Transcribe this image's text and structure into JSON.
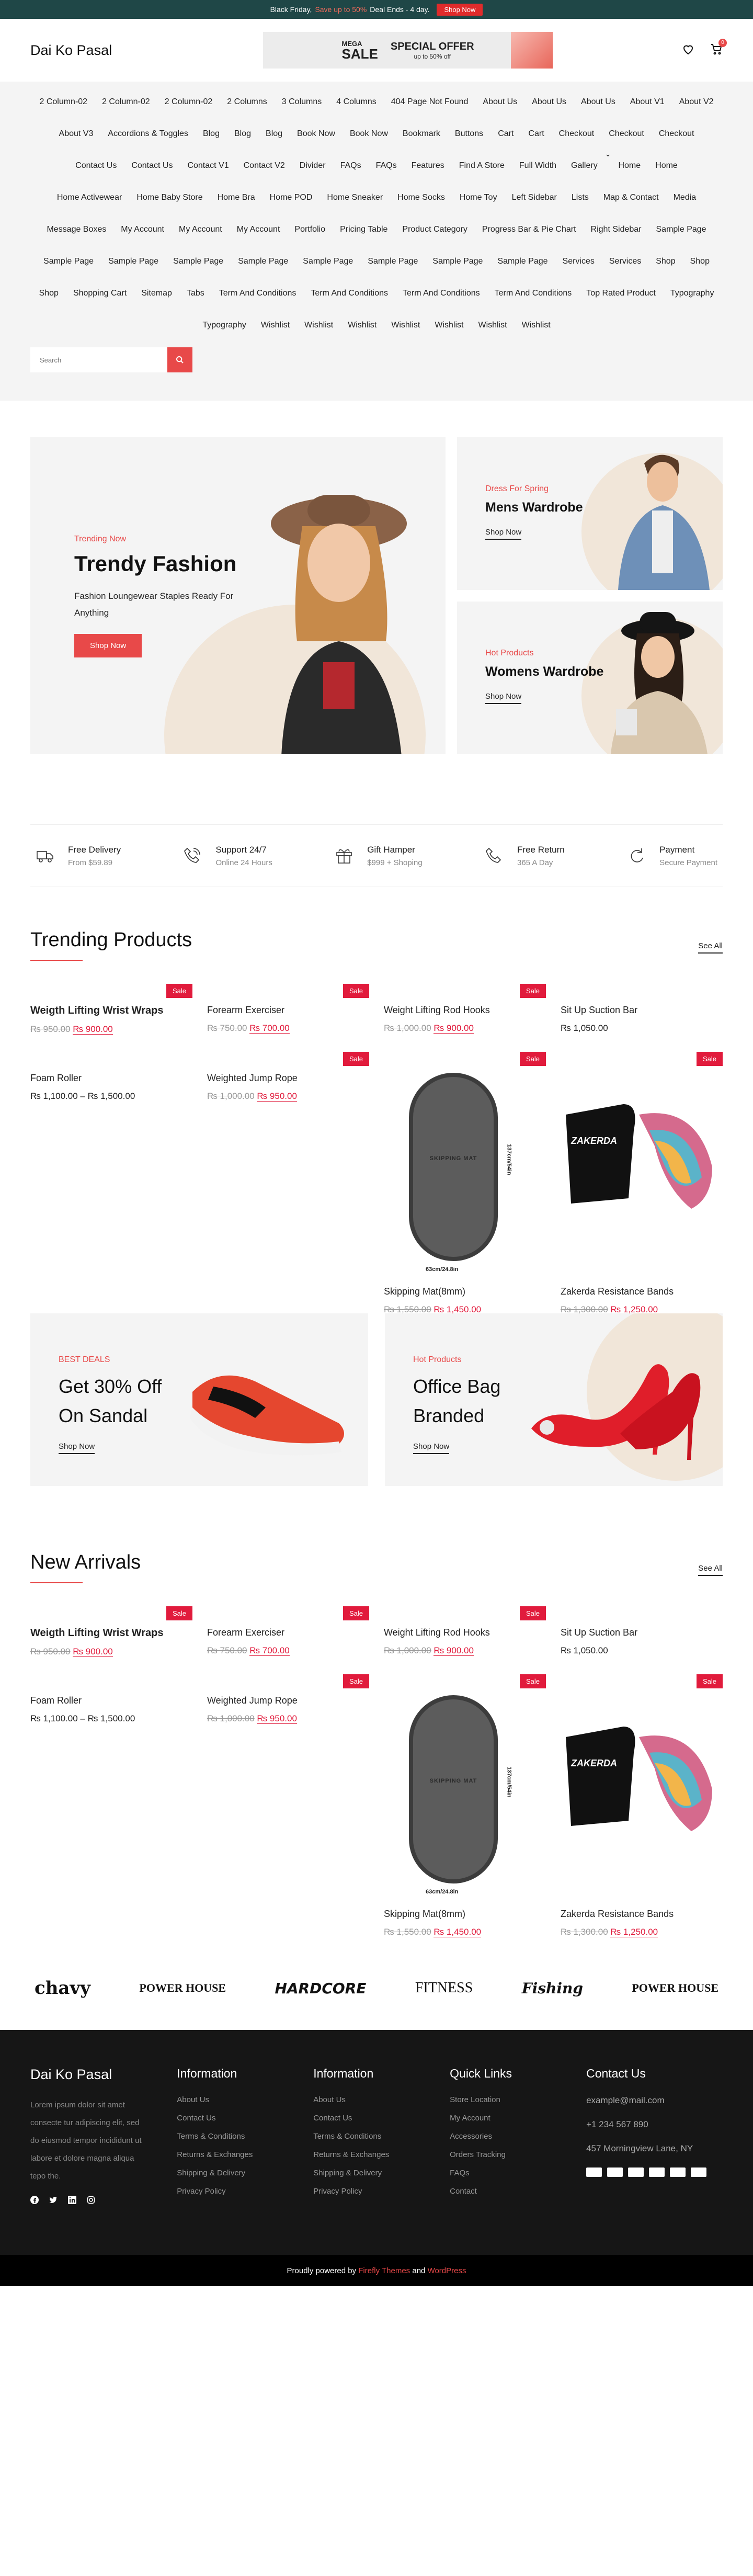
{
  "topbar": {
    "text1": "Black Friday,",
    "highlight": "Save up to 50%",
    "text2": "Deal Ends - 4 day.",
    "button": "Shop Now"
  },
  "header": {
    "logo": "Dai Ko Pasal",
    "banner": {
      "mega": "MEGA",
      "sale": "SALE",
      "offer": "SPECIAL OFFER",
      "offer_sub": "up to 50% off"
    },
    "cart_count": "0"
  },
  "nav": [
    "2 Column-02",
    "2 Column-02",
    "2 Column-02",
    "2 Columns",
    "3 Columns",
    "4 Columns",
    "404 Page Not Found",
    "About Us",
    "About Us",
    "About Us",
    "About V1",
    "About V2",
    "About V3",
    "Accordions & Toggles",
    "Blog",
    "Blog",
    "Blog",
    "Book Now",
    "Book Now",
    "Bookmark",
    "Buttons",
    "Cart",
    "Cart",
    "Checkout",
    "Checkout",
    "Checkout",
    "Contact Us",
    "Contact Us",
    "Contact V1",
    "Contact V2",
    "Divider",
    "FAQs",
    "FAQs",
    "Features",
    "Find A Store",
    "Full Width",
    "Gallery",
    "Home",
    "Home",
    "Home Activewear",
    "Home Baby Store",
    "Home Bra",
    "Home POD",
    "Home Sneaker",
    "Home Socks",
    "Home Toy",
    "Left Sidebar",
    "Lists",
    "Map & Contact",
    "Media",
    "Message Boxes",
    "My Account",
    "My Account",
    "My Account",
    "Portfolio",
    "Pricing Table",
    "Product Category",
    "Progress Bar & Pie Chart",
    "Right Sidebar",
    "Sample Page",
    "Sample Page",
    "Sample Page",
    "Sample Page",
    "Sample Page",
    "Sample Page",
    "Sample Page",
    "Sample Page",
    "Sample Page",
    "Services",
    "Services",
    "Shop",
    "Shop",
    "Shop",
    "Shopping Cart",
    "Sitemap",
    "Tabs",
    "Term And Conditions",
    "Term And Conditions",
    "Term And Conditions",
    "Term And Conditions",
    "Top Rated Product",
    "Typography",
    "Typography",
    "Wishlist",
    "Wishlist",
    "Wishlist",
    "Wishlist",
    "Wishlist",
    "Wishlist",
    "Wishlist"
  ],
  "search": {
    "placeholder": "Search"
  },
  "hero": {
    "main": {
      "tag": "Trending Now",
      "title": "Trendy Fashion",
      "subtitle": "Fashion Loungewear Staples Ready For Anything",
      "button": "Shop Now"
    },
    "side1": {
      "tag": "Dress For Spring",
      "title": "Mens Wardrobe",
      "link": "Shop Now"
    },
    "side2": {
      "tag": "Hot Products",
      "title": "Womens Wardrobe",
      "link": "Shop Now"
    }
  },
  "features": [
    {
      "title": "Free Delivery",
      "sub": "From $59.89",
      "icon": "truck-icon"
    },
    {
      "title": "Support 24/7",
      "sub": "Online 24 Hours",
      "icon": "phone-support-icon"
    },
    {
      "title": "Gift Hamper",
      "sub": "$999 + Shoping",
      "icon": "gift-icon"
    },
    {
      "title": "Free Return",
      "sub": "365 A Day",
      "icon": "phone-icon"
    },
    {
      "title": "Payment",
      "sub": "Secure Payment",
      "icon": "refresh-icon"
    }
  ],
  "trending": {
    "title": "Trending Products",
    "see_all": "See All",
    "products": [
      {
        "name": "Weigth Lifting Wrist Wraps",
        "old": "₨ 950.00",
        "new": "₨ 900.00",
        "sale": "Sale"
      },
      {
        "name": "Forearm Exerciser",
        "old": "₨ 750.00",
        "new": "₨ 700.00",
        "sale": "Sale"
      },
      {
        "name": "Weight Lifting Rod Hooks",
        "old": "₨ 1,000.00",
        "new": "₨ 900.00",
        "sale": "Sale"
      },
      {
        "name": "Sit Up Suction Bar",
        "price": "₨ 1,050.00"
      },
      {
        "name": "Foam Roller",
        "price": "₨ 1,100.00 – ₨ 1,500.00"
      },
      {
        "name": "Weighted Jump Rope",
        "old": "₨ 1,000.00",
        "new": "₨ 950.00",
        "sale": "Sale"
      },
      {
        "name": "Skipping Mat(8mm)",
        "old": "₨ 1,550.00",
        "new": "₨ 1,450.00",
        "sale": "Sale",
        "mat_label": "SKIPPING MAT",
        "mat_width": "63cm/24.8in",
        "mat_height": "137cm/54in"
      },
      {
        "name": "Zakerda Resistance Bands",
        "old": "₨ 1,300.00",
        "new": "₨ 1,250.00",
        "sale": "Sale",
        "bag_label": "ZAKERDA"
      }
    ]
  },
  "promos": [
    {
      "tag": "BEST DEALS",
      "title1": "Get 30% Off",
      "title2": "On Sandal",
      "link": "Shop Now"
    },
    {
      "tag": "Hot Products",
      "title1": "Office Bag",
      "title2": "Branded",
      "link": "Shop Now"
    }
  ],
  "arrivals": {
    "title": "New Arrivals",
    "see_all": "See All"
  },
  "brands": [
    "chavy",
    "POWER HOUSE",
    "HARDCORE",
    "FITNESS",
    "Fishing",
    "POWER HOUSE"
  ],
  "footer": {
    "logo": "Dai Ko Pasal",
    "desc": "Lorem ipsum dolor sit amet consecte tur adipiscing elit, sed do eiusmod tempor incididunt ut labore et dolore magna aliqua tepo the.",
    "info1": {
      "title": "Information",
      "links": [
        "About Us",
        "Contact Us",
        "Terms & Conditions",
        "Returns & Exchanges",
        "Shipping & Delivery",
        "Privacy Policy"
      ]
    },
    "info2": {
      "title": "Information",
      "links": [
        "About Us",
        "Contact Us",
        "Terms & Conditions",
        "Returns & Exchanges",
        "Shipping & Delivery",
        "Privacy Policy"
      ]
    },
    "quick": {
      "title": "Quick Links",
      "links": [
        "Store Location",
        "My Account",
        "Accessories",
        "Orders Tracking",
        "FAQs",
        "Contact"
      ]
    },
    "contact": {
      "title": "Contact Us",
      "email": "example@mail.com",
      "phone": "+1 234 567 890",
      "address": "457 Morningview Lane, NY"
    }
  },
  "bottombar": {
    "text1": "Proudly powered by",
    "link1": "Firefly Themes",
    "text2": "and",
    "link2": "WordPress"
  },
  "colors": {
    "accent": "#e84949",
    "topbar": "#1f4747",
    "footer": "#161616"
  }
}
